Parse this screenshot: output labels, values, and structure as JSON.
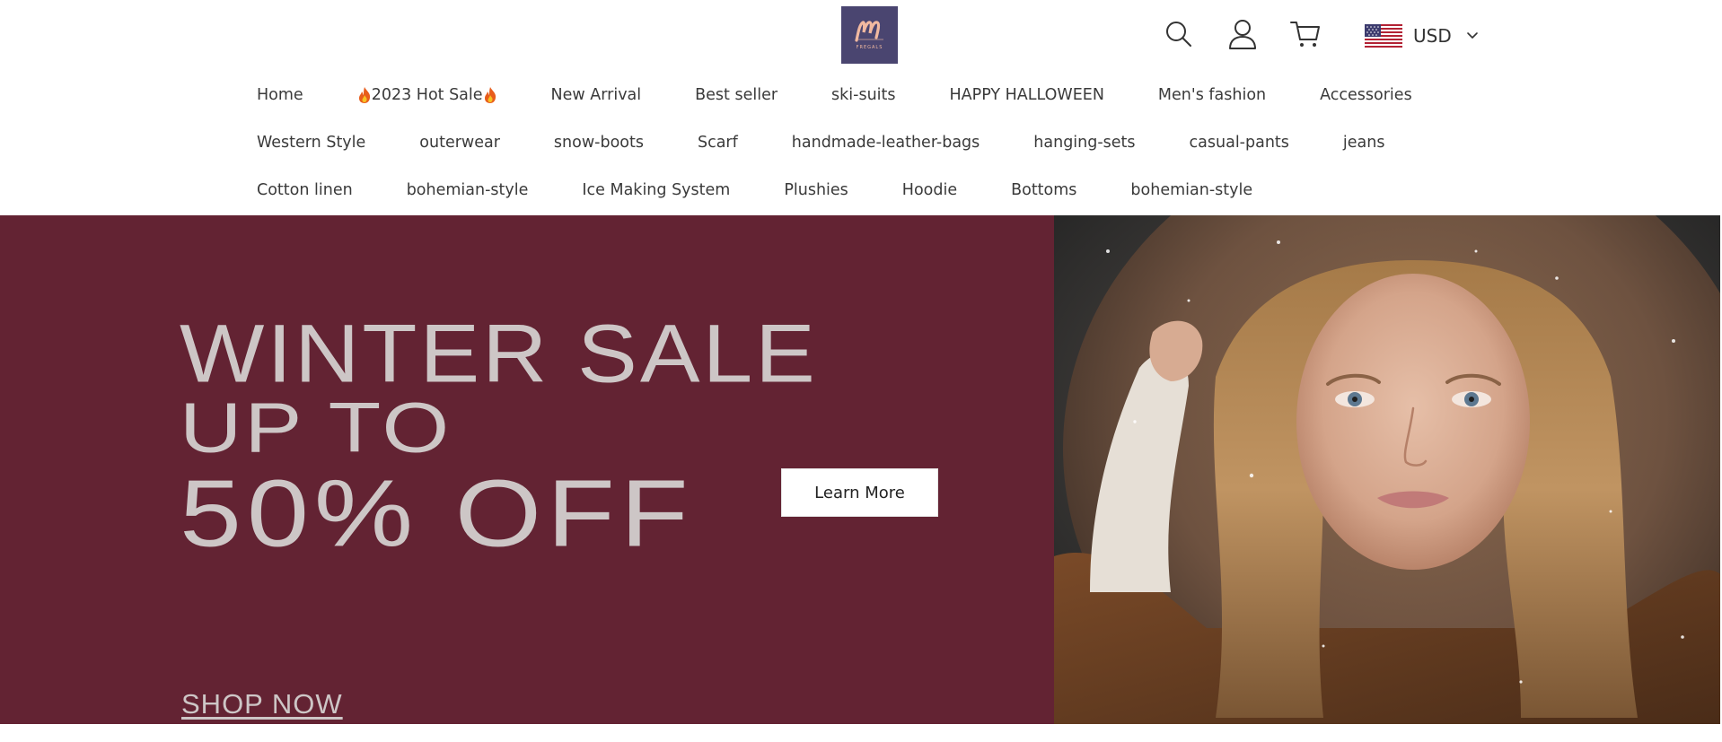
{
  "header": {
    "logo_text": "FREGALS",
    "icons": [
      "search-icon",
      "account-icon",
      "cart-icon"
    ],
    "currency": {
      "code": "USD",
      "flag": "us-flag-icon"
    }
  },
  "nav": {
    "row1": [
      {
        "label": "Home"
      },
      {
        "label": "2023 Hot Sale",
        "icon": "fire-icon"
      },
      {
        "label": "New Arrival"
      },
      {
        "label": "Best seller"
      },
      {
        "label": "ski-suits"
      },
      {
        "label": "HAPPY HALLOWEEN"
      },
      {
        "label": "Men's fashion"
      },
      {
        "label": "Accessories"
      }
    ],
    "row2": [
      {
        "label": "Western Style"
      },
      {
        "label": "outerwear"
      },
      {
        "label": "snow-boots"
      },
      {
        "label": "Scarf"
      },
      {
        "label": "handmade-leather-bags"
      },
      {
        "label": "hanging-sets"
      },
      {
        "label": "casual-pants"
      },
      {
        "label": "jeans"
      }
    ],
    "row3": [
      {
        "label": "Cotton linen"
      },
      {
        "label": "bohemian-style"
      },
      {
        "label": "Ice Making System"
      },
      {
        "label": "Plushies"
      },
      {
        "label": "Hoodie"
      },
      {
        "label": "Bottoms"
      },
      {
        "label": "bohemian-style"
      }
    ]
  },
  "hero": {
    "line1": "WINTER SALE",
    "line2": "UP TO",
    "line3": "50% OFF",
    "cta": "Learn More",
    "shop_now": "SHOP NOW",
    "bg_color": "#632333",
    "text_color": "#cdc6c6"
  }
}
